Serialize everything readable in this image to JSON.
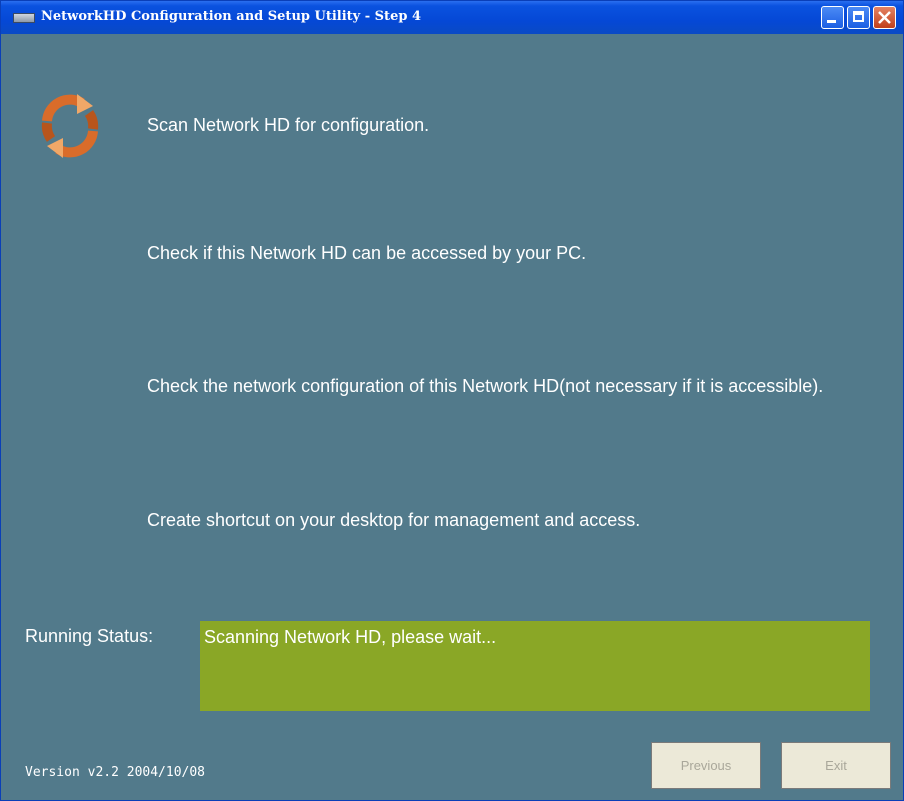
{
  "window": {
    "title": "NetworkHD Configuration and Setup Utility - Step 4"
  },
  "steps": [
    "Scan Network HD for configuration.",
    "Check if this Network HD can be accessed by your PC.",
    "Check the network configuration of this Network HD(not necessary if it is accessible).",
    "Create shortcut on your desktop for management and access."
  ],
  "status": {
    "label": "Running Status:",
    "message": "Scanning Network HD, please wait..."
  },
  "footer": {
    "version": "Version v2.2  2004/10/08",
    "previous_label": "Previous",
    "exit_label": "Exit"
  },
  "colors": {
    "window_bg": "#527a8b",
    "status_bg": "#8aa726",
    "titlebar": "#0548d6"
  },
  "icons": {
    "current_step_icon": "refresh-arrows-icon"
  }
}
